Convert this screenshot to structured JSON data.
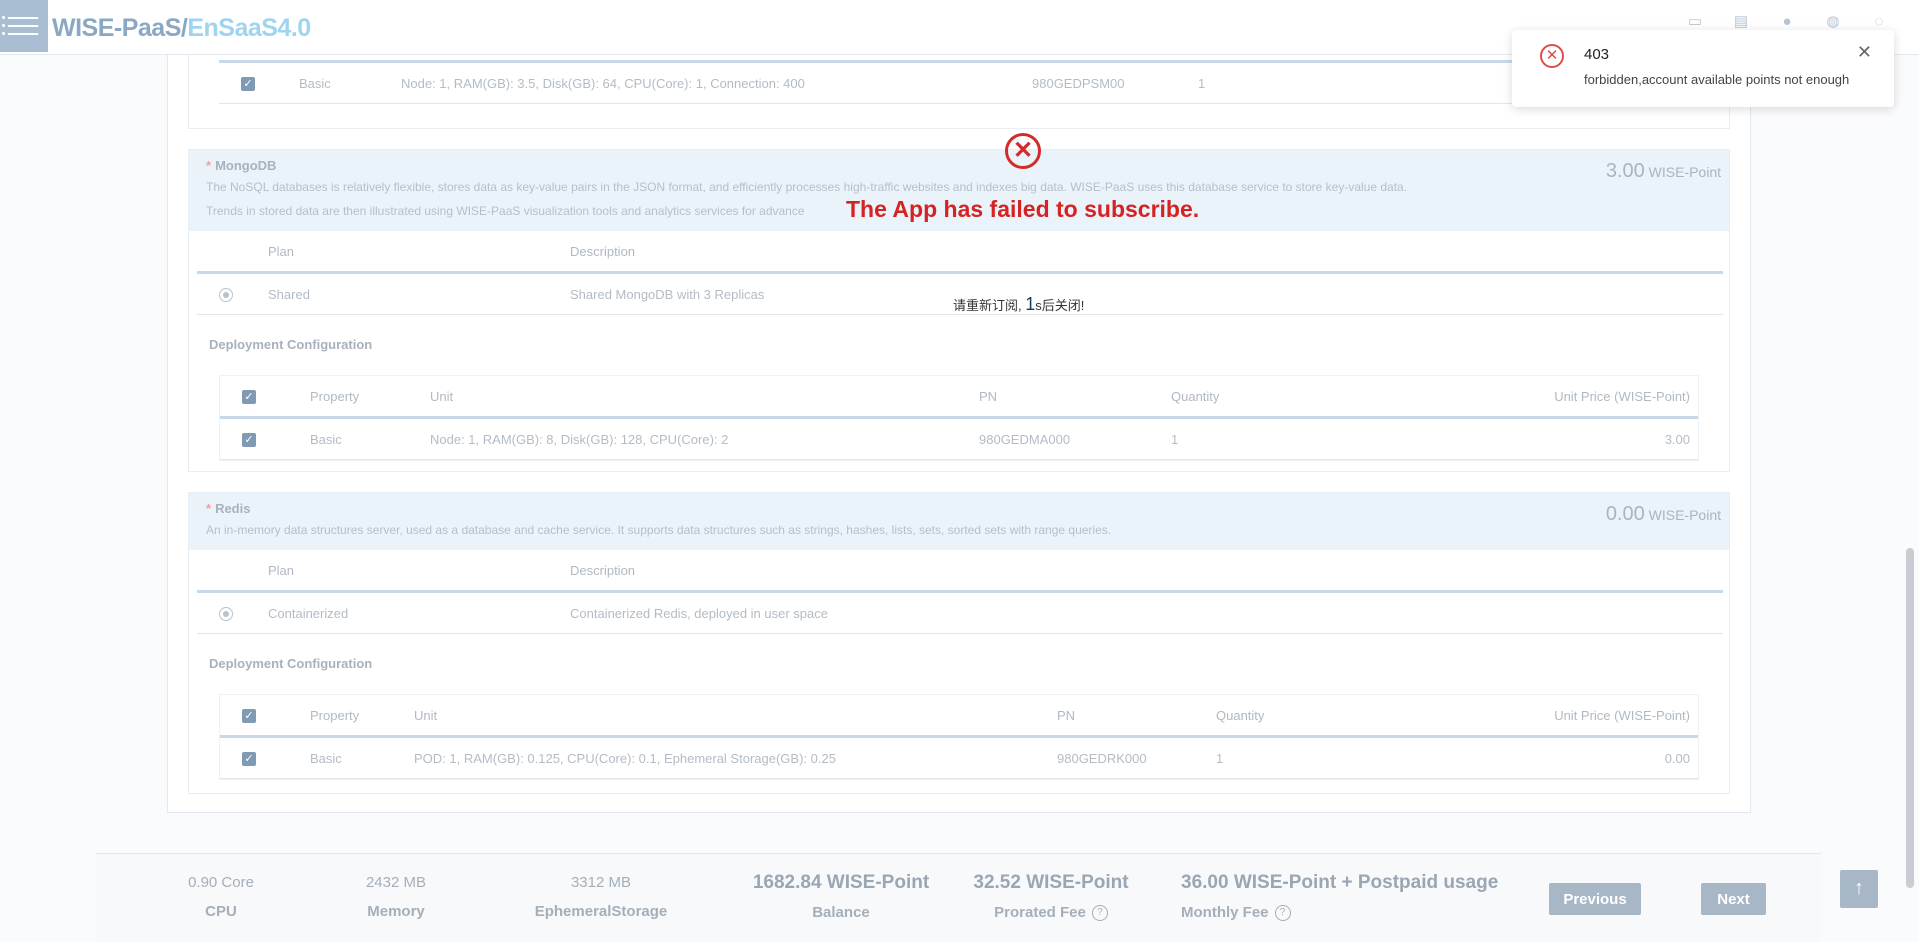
{
  "header": {
    "brand_part1": "WISE-PaaS/",
    "brand_part2": "EnSaaS4.0",
    "icons": [
      "window-icon",
      "document-icon",
      "location-icon",
      "globe-icon",
      "user-icon"
    ]
  },
  "top_partial_row": {
    "property": "Basic",
    "unit": "Node: 1, RAM(GB): 3.5, Disk(GB): 64, CPU(Core): 1, Connection: 400",
    "pn": "980GEDPSM00",
    "quantity": "1"
  },
  "mongodb": {
    "required_mark": "*",
    "title": "MongoDB",
    "desc_line1": "The NoSQL databases is relatively flexible, stores data as key-value pairs in the JSON format, and efficiently processes high-traffic websites and indexes big data. WISE-PaaS uses this database service to store key-value data.",
    "desc_line2": "Trends in stored data are then illustrated using WISE-PaaS visualization tools and analytics services for advance",
    "price_value": "3.00",
    "price_unit": "WISE-Point",
    "plan_header": {
      "plan": "Plan",
      "description": "Description"
    },
    "plan": {
      "name": "Shared",
      "description": "Shared MongoDB with 3 Replicas"
    },
    "deploy_label": "Deployment Configuration",
    "config_header": {
      "property": "Property",
      "unit": "Unit",
      "pn": "PN",
      "quantity": "Quantity",
      "unit_price": "Unit Price (WISE-Point)"
    },
    "config_row": {
      "property": "Basic",
      "unit": "Node: 1, RAM(GB): 8, Disk(GB): 128, CPU(Core): 2",
      "pn": "980GEDMA000",
      "quantity": "1",
      "unit_price": "3.00"
    }
  },
  "redis": {
    "required_mark": "*",
    "title": "Redis",
    "desc_line1": "An in-memory data structures server, used as a database and cache service. It supports data structures such as strings, hashes, lists, sets, sorted sets with range queries.",
    "price_value": "0.00",
    "price_unit": "WISE-Point",
    "plan_header": {
      "plan": "Plan",
      "description": "Description"
    },
    "plan": {
      "name": "Containerized",
      "description": "Containerized Redis, deployed in user space"
    },
    "deploy_label": "Deployment Configuration",
    "config_header": {
      "property": "Property",
      "unit": "Unit",
      "pn": "PN",
      "quantity": "Quantity",
      "unit_price": "Unit Price (WISE-Point)"
    },
    "config_row": {
      "property": "Basic",
      "unit": "POD: 1, RAM(GB): 0.125, CPU(Core): 0.1, Ephemeral Storage(GB): 0.25",
      "pn": "980GEDRK000",
      "quantity": "1",
      "unit_price": "0.00"
    }
  },
  "fail_overlay": {
    "message": "The App has failed to subscribe.",
    "countdown_prefix": "请重新订阅, ",
    "countdown_number": "1",
    "countdown_suffix": "s后关闭!"
  },
  "toast": {
    "title": "403",
    "message": "forbidden,account available points not enough",
    "close_glyph": "✕"
  },
  "footer": {
    "cpu_value": "0.90 Core",
    "cpu_label": "CPU",
    "memory_value": "2432 MB",
    "memory_label": "Memory",
    "ephemeral_value": "3312 MB",
    "ephemeral_label": "EphemeralStorage",
    "balance_value": "1682.84 WISE-Point",
    "balance_label": "Balance",
    "prorated_value": "32.52 WISE-Point",
    "prorated_label": "Prorated Fee",
    "monthly_value": "36.00 WISE-Point + Postpaid usage",
    "monthly_label": "Monthly Fee",
    "previous_label": "Previous",
    "next_label": "Next"
  }
}
